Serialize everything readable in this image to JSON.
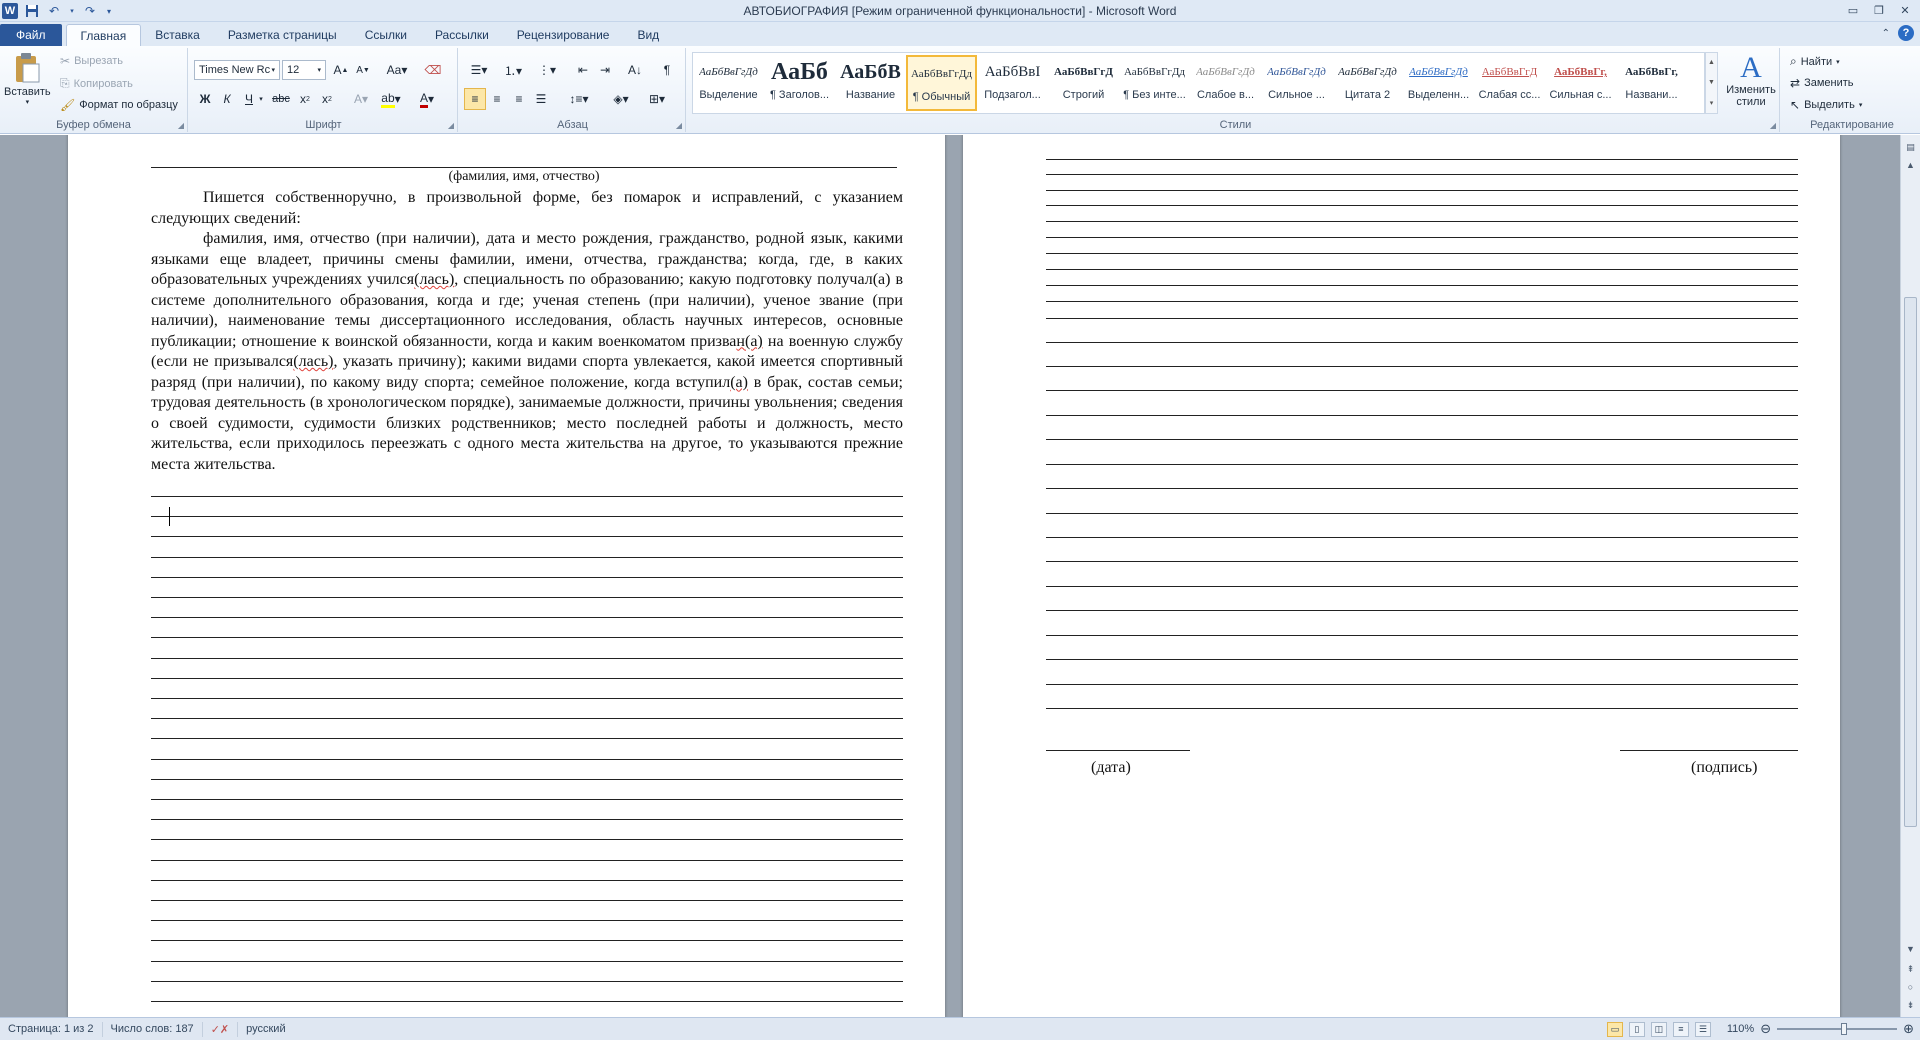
{
  "window": {
    "title": "АВТОБИОГРАФИЯ [Режим ограниченной функциональности] - Microsoft Word",
    "app_icon": "W",
    "controls": [
      "minimize-icon",
      "restore-icon",
      "close-icon"
    ]
  },
  "tabs": {
    "file": "Файл",
    "items": [
      "Главная",
      "Вставка",
      "Разметка страницы",
      "Ссылки",
      "Рассылки",
      "Рецензирование",
      "Вид"
    ],
    "active": "Главная"
  },
  "clipboard": {
    "paste": "Вставить",
    "cut": "Вырезать",
    "copy": "Копировать",
    "format_painter": "Формат по образцу",
    "group_label": "Буфер обмена"
  },
  "font": {
    "family": "Times New Rc",
    "size": "12",
    "group_label": "Шрифт",
    "accent_red": "#c00000",
    "highlight_yellow": "#ffff00"
  },
  "paragraph": {
    "group_label": "Абзац"
  },
  "styles": {
    "group_label": "Стили",
    "items": [
      {
        "sample": "АаБбВвГгДд",
        "name": "Выделение"
      },
      {
        "sample": "АаБб",
        "name": "¶ Заголов..."
      },
      {
        "sample": "АаБбВ",
        "name": "Название"
      },
      {
        "sample": "АаБбВвГгДд",
        "name": "¶ Обычный"
      },
      {
        "sample": "АаБбВвI",
        "name": "Подзагол..."
      },
      {
        "sample": "АаБбВвГгД",
        "name": "Строгий"
      },
      {
        "sample": "АаБбВвГгДд",
        "name": "¶ Без инте..."
      },
      {
        "sample": "АаБбВвГгДд",
        "name": "Слабое в..."
      },
      {
        "sample": "АаБбВвГгДд",
        "name": "Сильное ..."
      },
      {
        "sample": "АаБбВвГгДд",
        "name": "Цитата 2"
      },
      {
        "sample": "АаБбВвГгДд",
        "name": "Выделенн..."
      },
      {
        "sample": "АаБбВвГгД",
        "name": "Слабая сс..."
      },
      {
        "sample": "АаБбВвГг,",
        "name": "Сильная с..."
      },
      {
        "sample": "АаБбВвГг,",
        "name": "Названи..."
      }
    ],
    "selected_index": 3,
    "change_styles": "Изменить стили"
  },
  "editing": {
    "group_label": "Редактирование",
    "find": "Найти",
    "replace": "Заменить",
    "select": "Выделить"
  },
  "document": {
    "caption_fio": "(фамилия, имя, отчество)",
    "intro": "Пишется собственноручно, в произвольной форме, без помарок и исправлений, с указанием следующих сведений:",
    "body_pre": "фамилия, имя, отчество (при наличии), дата и место рождения, гражданство, родной язык, какими языками еще владеет, причины смены фамилии, имени, отчества, гражданства; когда, где, в каких образовательных учреждениях учился",
    "body_s1": "(лась)",
    "body_mid1": ", специальность по образованию; какую подготовку получал(а) в системе дополнительного образования, когда и где; ученая степень (при наличии), ученое звание (при наличии), наименование темы диссертационного исследования, область научных интересов, основные публикации; отношение к воинской обязанности, когда и каким военкоматом призва",
    "body_s2": "н(а)",
    "body_mid2": " на военную службу (если не призывался",
    "body_s3": "(лась)",
    "body_mid3": ", указать причину); какими видами спорта увлекается, какой имеется спортивный разряд (при наличии), по какому виду спорта; семейное положение, когда вступил",
    "body_s4": "(а)",
    "body_post": " в брак, состав семьи; трудовая деятельность (в хронологическом порядке), занимаемые должности, причины увольнения; сведения о своей судимости, судимости близких родственников; место последней работы и должность, место жительства, если приходилось переезжать с одного места жительства на другое, то указываются прежние места жительства.",
    "date_label": "(дата)",
    "signature_label": "(подпись)"
  },
  "status": {
    "page": "Страница: 1 из 2",
    "words": "Число слов: 187",
    "language": "русский",
    "zoom": "110%",
    "zoom_percent": 110
  }
}
